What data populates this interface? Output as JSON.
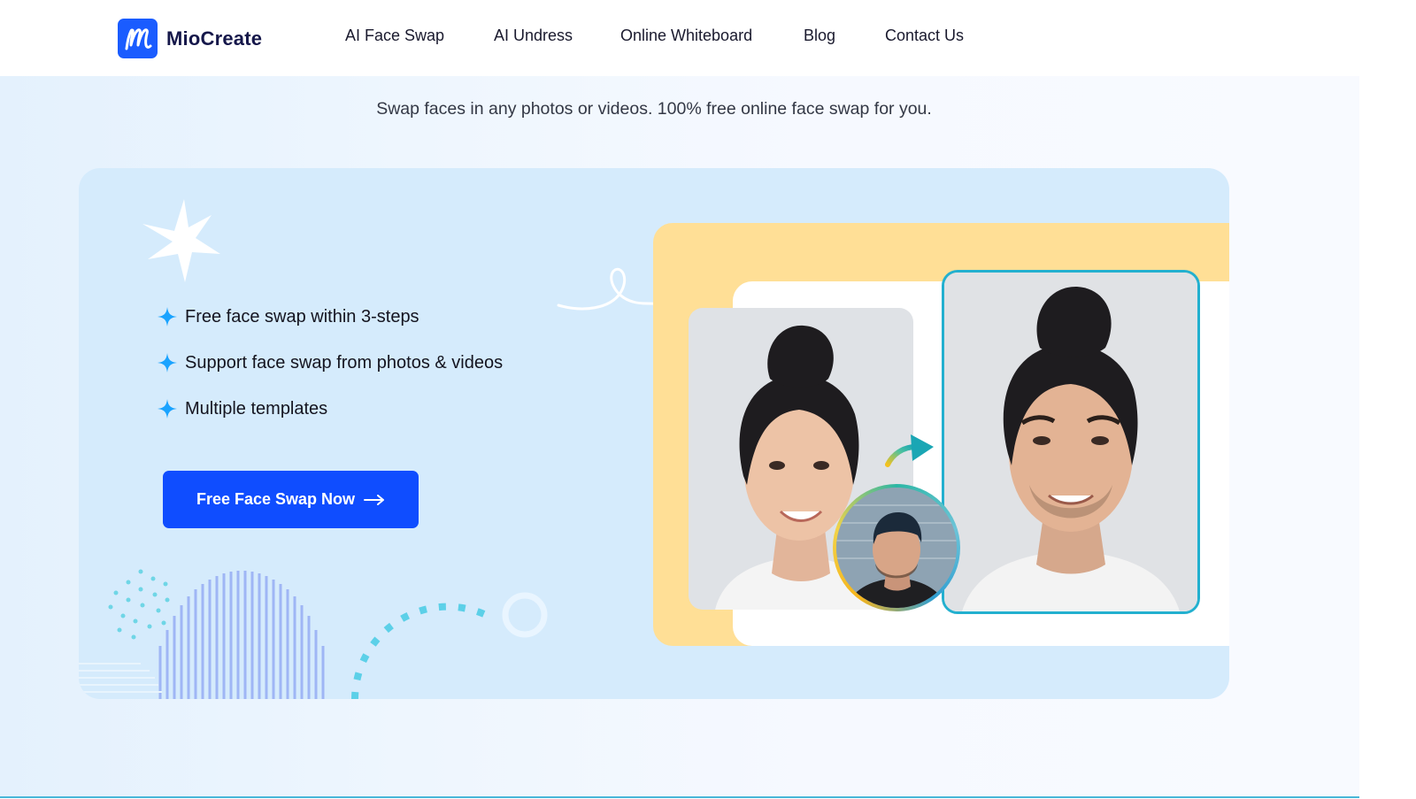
{
  "brand": {
    "name": "MioCreate",
    "logo_icon": "miocreate-m-logo",
    "accent": "#1a5cff"
  },
  "nav": [
    {
      "label": "AI Face Swap"
    },
    {
      "label": "AI Undress"
    },
    {
      "label": "Online Whiteboard"
    },
    {
      "label": "Blog"
    },
    {
      "label": "Contact Us"
    }
  ],
  "hero": {
    "tagline": "Swap faces in any photos or videos. 100% free online face swap for you.",
    "features": [
      {
        "text": "Free face swap within 3-steps",
        "icon": "sparkle-icon"
      },
      {
        "text": "Support face swap from photos & videos",
        "icon": "sparkle-icon"
      },
      {
        "text": "Multiple templates",
        "icon": "sparkle-icon"
      }
    ],
    "cta_label": "Free Face Swap Now",
    "cta_icon": "arrow-right-icon",
    "cta_color": "#0f4dff"
  },
  "illustration": {
    "source_photo": "woman-portrait",
    "face_photo": "man-with-cap-portrait",
    "result_photo": "face-swapped-portrait",
    "swap_arrow": "curved-arrow-icon",
    "panel_color": "#ffdf96",
    "frame_color": "#23b0cf"
  }
}
